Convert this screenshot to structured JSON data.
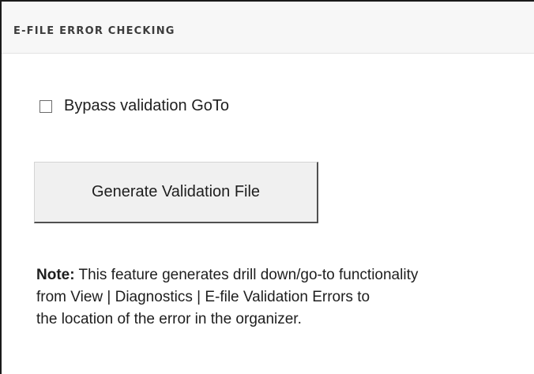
{
  "panel": {
    "title": "E-FILE ERROR CHECKING"
  },
  "options": {
    "bypass_checkbox": {
      "label": "Bypass validation GoTo",
      "checked": false
    }
  },
  "actions": {
    "generate_button_label": "Generate Validation File"
  },
  "note": {
    "label": "Note:",
    "line1": "This feature generates drill down/go-to functionality",
    "line2": "from View | Diagnostics | E-file Validation Errors to",
    "line3": "the location of the error in the organizer."
  },
  "colors": {
    "header_background": "#f7f7f7",
    "button_background": "#f0f0f0",
    "text": "#1e1e1e"
  }
}
